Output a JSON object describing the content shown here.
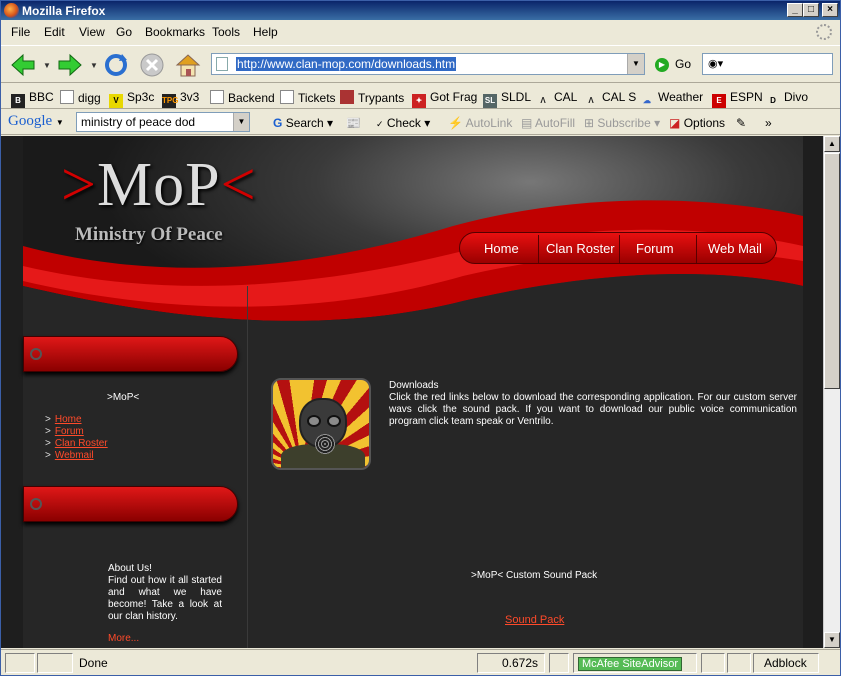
{
  "window": {
    "title": "Mozilla Firefox"
  },
  "menu": [
    "File",
    "Edit",
    "View",
    "Go",
    "Bookmarks",
    "Tools",
    "Help"
  ],
  "nav": {
    "url": "http://www.clan-mop.com/downloads.htm",
    "go_label": "Go"
  },
  "bookmarks": [
    {
      "label": "BBC",
      "icon": "bbc-icon"
    },
    {
      "label": "digg",
      "icon": "page-icon"
    },
    {
      "label": "Sp3c",
      "icon": "sp3c-icon"
    },
    {
      "label": "3v3",
      "icon": "tpg-icon"
    },
    {
      "label": "Backend",
      "icon": "page-icon"
    },
    {
      "label": "Tickets",
      "icon": "page-icon"
    },
    {
      "label": "Trypants",
      "icon": "trypants-icon"
    },
    {
      "label": "Got Frag",
      "icon": "gotfrag-icon"
    },
    {
      "label": "SLDL",
      "icon": "sldl-icon"
    },
    {
      "label": "CAL",
      "icon": "cal-icon"
    },
    {
      "label": "CAL S",
      "icon": "cal-icon"
    },
    {
      "label": "Weather",
      "icon": "weather-icon"
    },
    {
      "label": "ESPN",
      "icon": "espn-icon"
    },
    {
      "label": "Divo",
      "icon": "divo-icon"
    }
  ],
  "google": {
    "logo": "Google",
    "query": "ministry of peace dod",
    "search": "Search",
    "check": "Check",
    "autolink": "AutoLink",
    "autofill": "AutoFill",
    "subscribe": "Subscribe",
    "options": "Options",
    "more": "»"
  },
  "site": {
    "logo_left": ">",
    "logo_text": "MoP",
    "logo_right": "<",
    "tagline": "Ministry Of Peace",
    "nav": [
      "Home",
      "Clan Roster",
      "Forum",
      "Web Mail"
    ],
    "side_title": ">MoP<",
    "side_links": [
      "Home",
      "Forum",
      "Clan Roster",
      "Webmail"
    ],
    "about_title": "About Us!",
    "about_text": "Find out how it all started and what we have become! Take a look at our clan history.",
    "about_more": "More...",
    "downloads_title": "Downloads",
    "downloads_text": "Click the red links below to download the corresponding application. For our custom server wavs click the sound pack. If you want to download our public voice communication program click team speak or Ventrilo.",
    "sound_title": ">MoP< Custom Sound Pack",
    "sound_link": "Sound Pack"
  },
  "status": {
    "text": "Done",
    "time": "0.672s",
    "mcafee": "McAfee SiteAdvisor",
    "adblock": "Adblock"
  },
  "colors": {
    "accent": "#d10000",
    "link": "#ff4a2a",
    "bg": "#262626"
  }
}
